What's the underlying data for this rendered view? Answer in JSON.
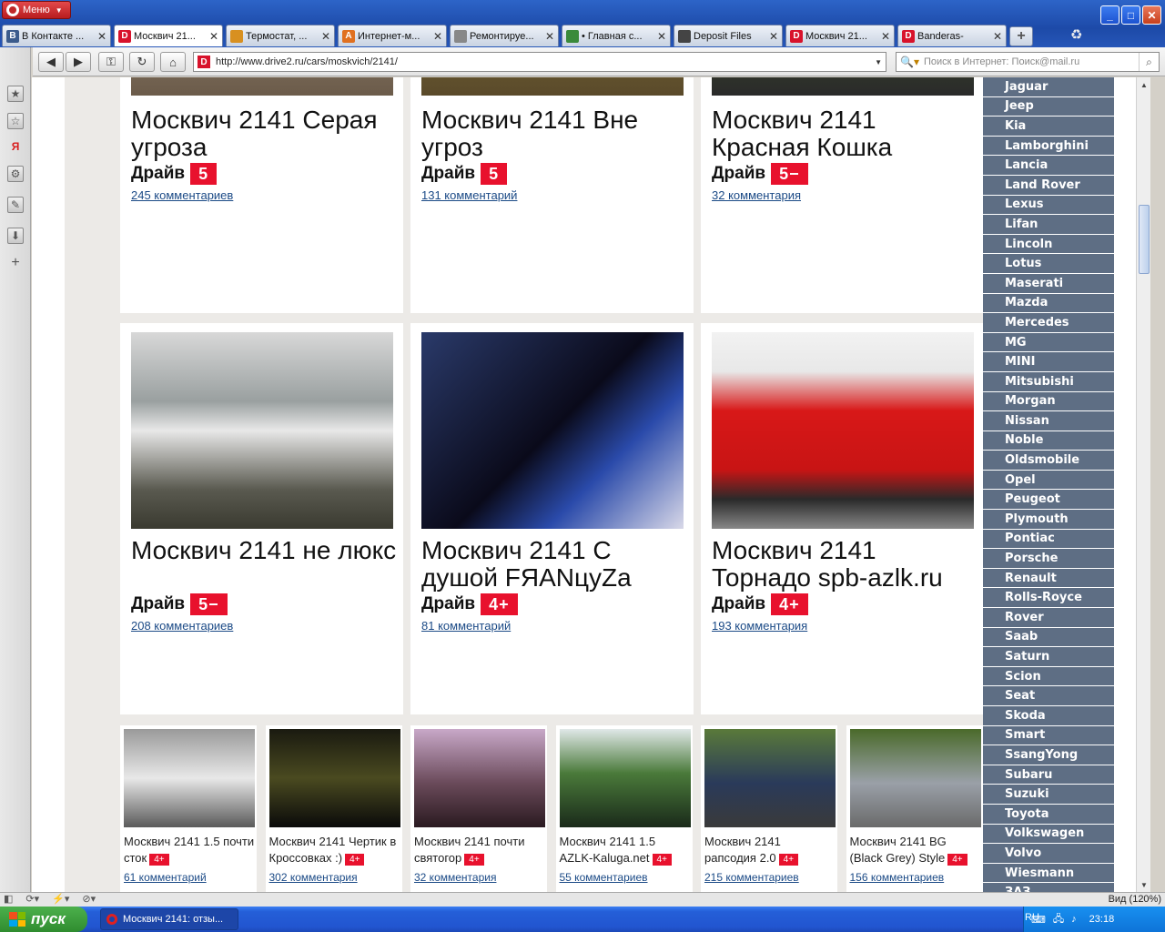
{
  "browser": {
    "menu_label": "Меню",
    "tabs": [
      {
        "title": "В Контакте ...",
        "fav": "B",
        "color": "#3b5b8c"
      },
      {
        "title": "Москвич 21...",
        "fav": "D",
        "color": "#d8122b"
      },
      {
        "title": "Термостат, ...",
        "fav": "",
        "color": "#d89020"
      },
      {
        "title": "Интернет-м...",
        "fav": "A",
        "color": "#e07020"
      },
      {
        "title": "Ремонтируе...",
        "fav": "",
        "color": "#888888"
      },
      {
        "title": "• Главная с...",
        "fav": "",
        "color": "#3a8a3a"
      },
      {
        "title": "Deposit Files",
        "fav": "",
        "color": "#444444"
      },
      {
        "title": "Москвич 21...",
        "fav": "D",
        "color": "#d8122b"
      },
      {
        "title": "Banderas-",
        "fav": "D",
        "color": "#d8122b"
      }
    ],
    "url": "http://www.drive2.ru/cars/moskvich/2141/",
    "search_placeholder": "Поиск в Интернет: Поиск@mail.ru"
  },
  "cards": [
    {
      "name": "Москвич 2141 Серая угроза",
      "drive": "Драйв",
      "badge": "5",
      "comments": "245 комментариев"
    },
    {
      "name": "Москвич 2141 Вне угроз",
      "drive": "Драйв",
      "badge": "5",
      "comments": "131 комментарий"
    },
    {
      "name": "Москвич 2141 Красная Кошка",
      "drive": "Драйв",
      "badge": "5−",
      "comments": "32 комментария"
    },
    {
      "name": "Москвич 2141 не люкс",
      "drive": "Драйв",
      "badge": "5−",
      "comments": "208 комментариев"
    },
    {
      "name": "Москвич 2141 С душой FЯANцуZa",
      "drive": "Драйв",
      "badge": "4+",
      "comments": "81 комментарий"
    },
    {
      "name": "Москвич 2141 Торнадо spb-azlk.ru",
      "drive": "Драйв",
      "badge": "4+",
      "comments": "193 комментария"
    }
  ],
  "small_cards": [
    {
      "name": "Москвич 2141 1.5 почти сток",
      "badge": "4+",
      "comments": "61 комментарий"
    },
    {
      "name": "Москвич 2141 Чертик в Кроссовках :)",
      "badge": "4+",
      "comments": "302 комментария"
    },
    {
      "name": "Москвич 2141 почти святогор",
      "badge": "4+",
      "comments": "32 комментария"
    },
    {
      "name": "Москвич 2141 1.5 AZLK-Kaluga.net",
      "badge": "4+",
      "comments": "55 комментариев"
    },
    {
      "name": "Москвич 2141 рапсодия 2.0",
      "badge": "4+",
      "comments": "215 комментариев"
    },
    {
      "name": "Москвич 2141 BG (Black Grey) Style",
      "badge": "4+",
      "comments": "156 комментариев"
    }
  ],
  "brands": [
    "Jaguar",
    "Jeep",
    "Kia",
    "Lamborghini",
    "Lancia",
    "Land Rover",
    "Lexus",
    "Lifan",
    "Lincoln",
    "Lotus",
    "Maserati",
    "Mazda",
    "Mercedes",
    "MG",
    "MINI",
    "Mitsubishi",
    "Morgan",
    "Nissan",
    "Noble",
    "Oldsmobile",
    "Opel",
    "Peugeot",
    "Plymouth",
    "Pontiac",
    "Porsche",
    "Renault",
    "Rolls-Royce",
    "Rover",
    "Saab",
    "Saturn",
    "Scion",
    "Seat",
    "Skoda",
    "Smart",
    "SsangYong",
    "Subaru",
    "Suzuki",
    "Toyota",
    "Volkswagen",
    "Volvo",
    "Wiesmann",
    "ЗАЗ"
  ],
  "statusbar": {
    "zoom": "Вид (120%)"
  },
  "taskbar": {
    "start_label": "пуск",
    "task_title": "Москвич 2141: отзы...",
    "lang": "RU",
    "clock": "23:18"
  }
}
